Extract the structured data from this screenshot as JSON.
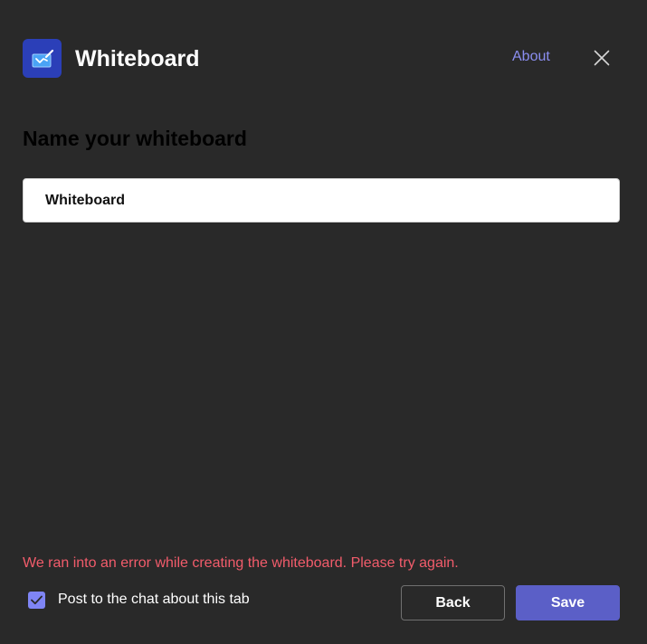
{
  "header": {
    "title": "Whiteboard",
    "about_label": "About",
    "app_icon": "whiteboard-app-icon",
    "close_icon": "close-icon"
  },
  "form": {
    "heading": "Name your whiteboard",
    "name_value": "Whiteboard"
  },
  "footer": {
    "error_message": "We ran into an error while creating the whiteboard. Please try again.",
    "post_to_chat_label": "Post to the chat about this tab",
    "post_to_chat_checked": true,
    "back_label": "Back",
    "save_label": "Save"
  },
  "colors": {
    "background": "#292929",
    "accent": "#5b5fc7",
    "link": "#8b8ef0",
    "error": "#f25c6b",
    "checkbox": "#7f85f5"
  }
}
